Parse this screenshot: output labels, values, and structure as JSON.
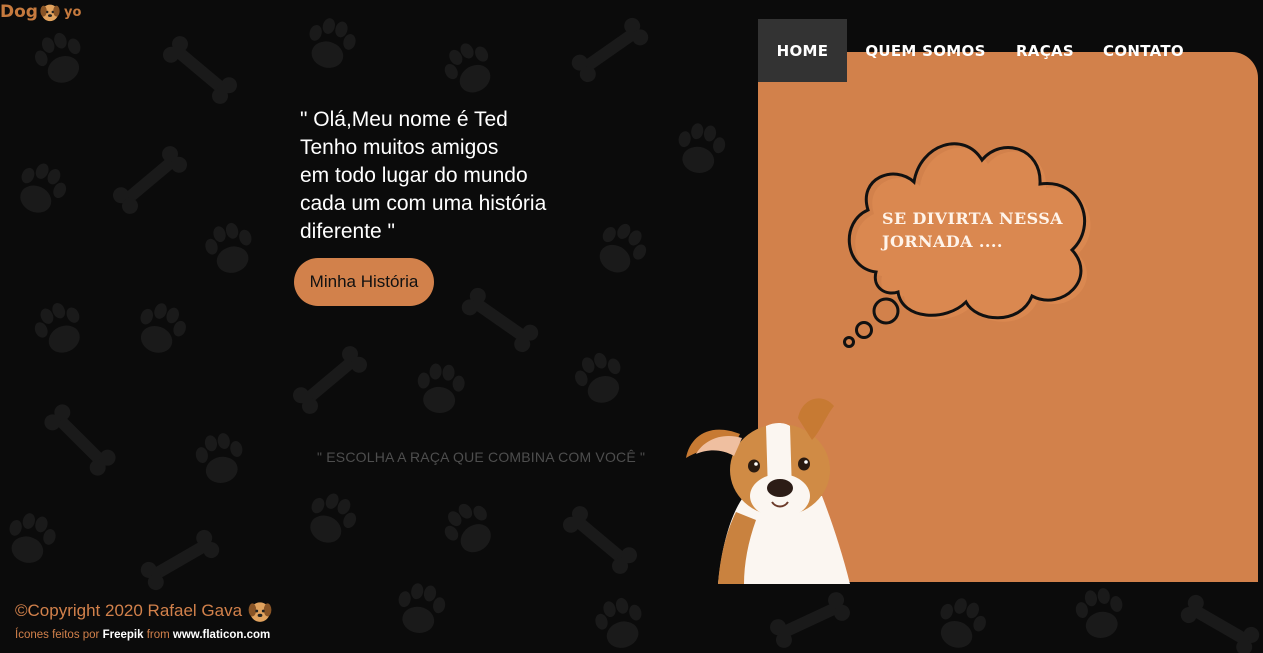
{
  "brand": {
    "left": "Dog",
    "right": "yo",
    "icon": "dog-face-icon"
  },
  "nav": {
    "items": [
      {
        "label": "HOME",
        "active": true
      },
      {
        "label": "QUEM SOMOS",
        "active": false
      },
      {
        "label": "RAÇAS",
        "active": false
      },
      {
        "label": "CONTATO",
        "active": false
      }
    ]
  },
  "hero": {
    "quote_lines": [
      "\" Olá,Meu nome é Ted",
      "Tenho muitos amigos",
      "em todo lugar do mundo",
      "cada um com uma história",
      "diferente \""
    ],
    "button_label": "Minha História",
    "tagline": "\" ESCOLHA A RAÇA QUE COMBINA COM VOCÊ \""
  },
  "bubble": {
    "lines": [
      "SE DIVIRTA NESSA",
      "JORNADA ...."
    ]
  },
  "footer": {
    "copyright": "©Copyright 2020 Rafael Gava",
    "credit_prefix": "Ícones feitos por",
    "credit_author": "Freepik",
    "credit_from": "from",
    "credit_site": "www.flaticon.com"
  },
  "colors": {
    "accent": "#d2814b",
    "background": "#0b0b0b",
    "nav_active": "#333333"
  }
}
